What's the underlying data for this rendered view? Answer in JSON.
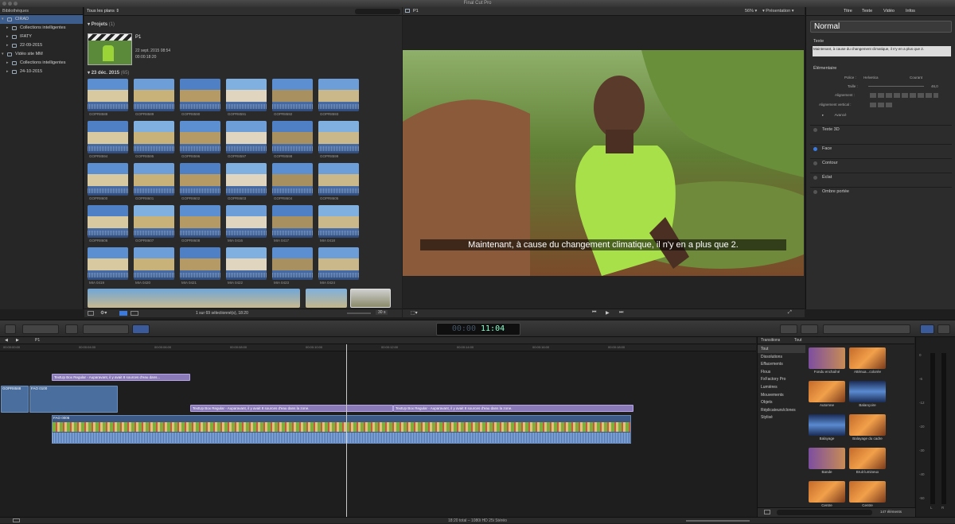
{
  "app_title": "Final Cut Pro",
  "libraries": {
    "header": "Bibliothèques",
    "items": [
      {
        "label": "CIRAD",
        "level": 0,
        "selected": true
      },
      {
        "label": "Collections intelligentes",
        "level": 1
      },
      {
        "label": "IFATY",
        "level": 1
      },
      {
        "label": "22-09-2015",
        "level": 1
      },
      {
        "label": "Vidéo site MM",
        "level": 0
      },
      {
        "label": "Collections intelligentes",
        "level": 1
      },
      {
        "label": "24-10-2015",
        "level": 1
      }
    ]
  },
  "browser": {
    "filter_label": "Tous les plans",
    "projects_label": "Projets",
    "projects_count": "(1)",
    "project_name": "P1",
    "project_date": "22 sept. 2015 08:54",
    "project_duration": "00:00:18:20",
    "event_label": "23 déc. 2015",
    "event_count": "(65)",
    "clips": [
      "GOPR8588",
      "GOPR8589",
      "GOPR8590",
      "GOPR8591",
      "GOPR8592",
      "GOPR8593",
      "GOPR8594",
      "GOPR8595",
      "GOPR8596",
      "GOPR8597",
      "GOPR8598",
      "GOPR8599",
      "GOPR8600",
      "GOPR8601",
      "GOPR8602",
      "GOPR8603",
      "GOPR8604",
      "GOPR8605",
      "GOPR8606",
      "GOPR8607",
      "GOPR8608",
      "MIA 0416",
      "MIA 0417",
      "MIA 0418",
      "MIA 0419",
      "MIA 0420",
      "MIA 0421",
      "MIA 0422",
      "MIA 0423",
      "MIA 0424"
    ],
    "status": "1 sur 69 sélectionné(s), 18:20",
    "zoom": "30 s"
  },
  "viewer": {
    "title": "P1",
    "zoom": "56%",
    "presentation": "Présentation",
    "subtitle": "Maintenant, à cause du changement climatique,  il n'y en a plus que 2."
  },
  "inspector": {
    "tabs": [
      "Titre",
      "Texte",
      "Vidéo",
      "Infos"
    ],
    "preset": "Normal",
    "text_label": "Texte",
    "text_value": "Maintenant, à cause du changement climatique,  il n'y en a plus que 2.",
    "basic_label": "Élémentaire",
    "font_label": "Police :",
    "font_value": "Helvetica",
    "style_value": "Courant",
    "size_label": "Taille :",
    "size_value": "46,0",
    "alignment_label": "Alignement :",
    "valign_label": "Alignement vertical :",
    "advanced_label": "Avancé",
    "sections": [
      "Texte 3D",
      "Face",
      "Contour",
      "Éclat",
      "Ombre portée"
    ]
  },
  "toolbar": {
    "timecode": "11:04",
    "timecode_dim": "00:00"
  },
  "timeline": {
    "project": "P1",
    "ruler": [
      "00:00:00:00",
      "00:00:04:00",
      "00:00:06:00",
      "00:00:08:00",
      "00:00:10:00",
      "00:00:12:00",
      "00:00:14:00",
      "00:00:16:00",
      "00:00:18:00"
    ],
    "title_clips": [
      "TextUp Box Regular - Auparavant, il y avait 8 sources d'eau dans...",
      "TextUp Box Regular - Auparavant, il y avait 8 sources d'eau dans la zone.",
      "TextUp Box Regular - Auparavant, il y avait 8 sources d'eau dans la zone."
    ],
    "clip_a": "GOPR8588",
    "clip_b": "FAO 0100",
    "primary_clip": "FAO 0006"
  },
  "transitions": {
    "header": "Transitions",
    "header_right": "Tout",
    "categories": [
      "Tout",
      "Dissolutions",
      "Effacements",
      "Flous",
      "FxFactory Pro",
      "Lumières",
      "Mouvements",
      "Objets",
      "Réplicateurs/clones",
      "Stylisé"
    ],
    "items": [
      "Fondu enchaîné",
      "Atténua...colorée",
      "Automne",
      "Balançoire",
      "Balayage",
      "Balayage du cadre",
      "Bande",
      "Bruit lumineux",
      "Centre",
      "Centre"
    ],
    "count": "147 éléments"
  },
  "meters": {
    "labels": [
      "0",
      "-6",
      "-12",
      "-20",
      "-30",
      "-40",
      "-50"
    ],
    "channels": [
      "L",
      "R"
    ]
  },
  "status_bar": "18:20 total – 1080i HD 25i Stéréo",
  "colors": {
    "accent": "#3d5d8c",
    "title_clip": "#8a7ab8",
    "video_clip": "#4a6f9e"
  }
}
